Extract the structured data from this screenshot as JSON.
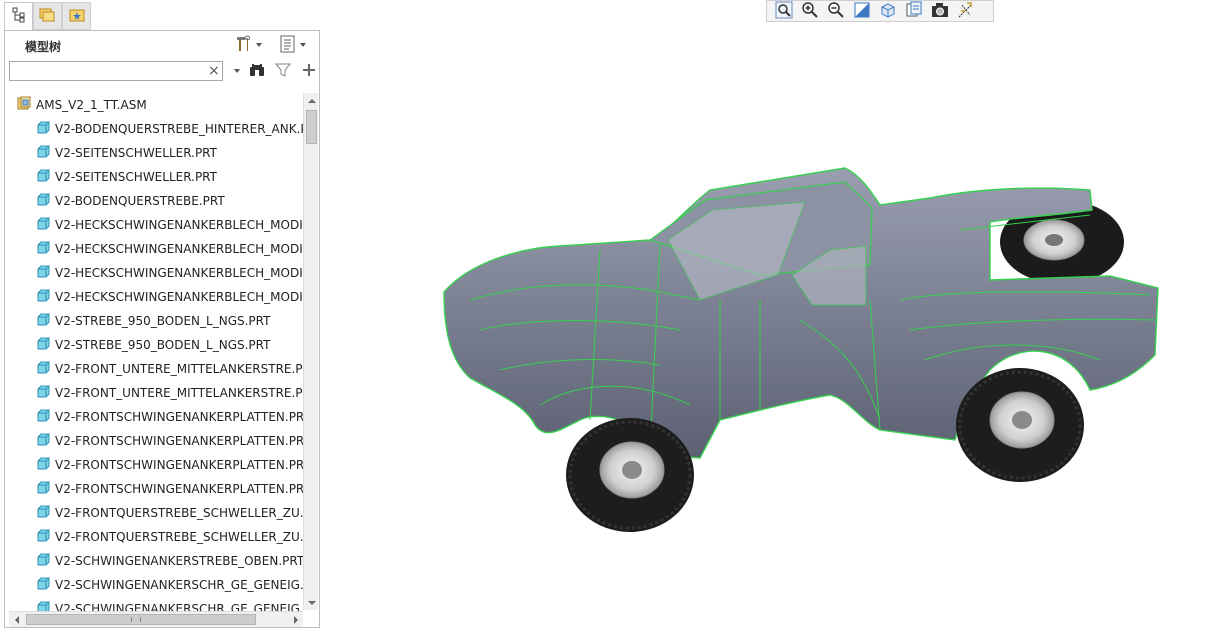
{
  "panel": {
    "title": "模型树"
  },
  "search": {
    "value": "",
    "clear_glyph": "×"
  },
  "tree": {
    "root": "AMS_V2_1_TT.ASM",
    "children": [
      "V2-BODENQUERSTREBE_HINTERER_ANK.P",
      "V2-SEITENSCHWELLER.PRT",
      "V2-SEITENSCHWELLER.PRT",
      "V2-BODENQUERSTREBE.PRT",
      "V2-HECKSCHWINGENANKERBLECH_MODI",
      "V2-HECKSCHWINGENANKERBLECH_MODI",
      "V2-HECKSCHWINGENANKERBLECH_MODI",
      "V2-HECKSCHWINGENANKERBLECH_MODI",
      "V2-STREBE_950_BODEN_L_NGS.PRT",
      "V2-STREBE_950_BODEN_L_NGS.PRT",
      "V2-FRONT_UNTERE_MITTELANKERSTRE.PI",
      "V2-FRONT_UNTERE_MITTELANKERSTRE.PI",
      "V2-FRONTSCHWINGENANKERPLATTEN.PR",
      "V2-FRONTSCHWINGENANKERPLATTEN.PR",
      "V2-FRONTSCHWINGENANKERPLATTEN.PR",
      "V2-FRONTSCHWINGENANKERPLATTEN.PR",
      "V2-FRONTQUERSTREBE_SCHWELLER_ZU.P",
      "V2-FRONTQUERSTREBE_SCHWELLER_ZU.P",
      "V2-SCHWINGENANKERSTREBE_OBEN.PRT",
      "V2-SCHWINGENANKERSCHR_GE_GENEIG.",
      "V2-SCHWINGENANKERSCHR_GE_GENEIG."
    ]
  },
  "colors": {
    "wireframe_edges": "#36d14e",
    "body_shade": "#7a7f92",
    "part_icon": "#5cc6e0"
  }
}
